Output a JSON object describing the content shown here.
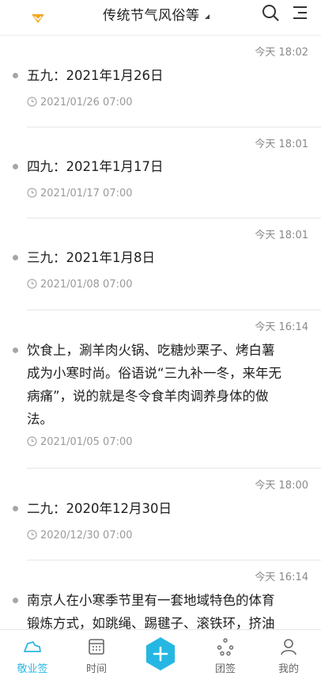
{
  "header": {
    "title": "传统节气风俗等",
    "icons": [
      "app-logo-icon",
      "search-icon",
      "menu-icon"
    ],
    "brand_color": "#f5a623"
  },
  "entries": [
    {
      "time": "今天 18:02",
      "text": "五九：2021年1月26日",
      "reminder": "2021/01/26 07:00"
    },
    {
      "time": "今天 18:01",
      "text": "四九：2021年1月17日",
      "reminder": "2021/01/17 07:00"
    },
    {
      "time": "今天 18:01",
      "text": "三九：2021年1月8日",
      "reminder": "2021/01/08 07:00"
    },
    {
      "time": "今天 16:14",
      "text_lines": [
        "饮食上，涮羊肉火锅、吃糖炒栗子、烤白薯",
        "成为小寒时尚。俗语说“三九补一冬，来年无",
        "病痛”，说的就是冬令食羊肉调养身体的做",
        "法。"
      ],
      "reminder": "2021/01/05 07:00"
    },
    {
      "time": "今天 18:00",
      "text": "二九：2020年12月30日",
      "reminder": "2020/12/30 07:00"
    },
    {
      "time": "今天 16:14",
      "text_lines": [
        "南京人在小寒季节里有一套地域特色的体育",
        "锻炼方式，如跳绳、踢毽子、滚铁环，挤油"
      ]
    }
  ],
  "tabbar": {
    "tabs": [
      {
        "label": "敬业签",
        "icon": "cloud-icon",
        "active": true
      },
      {
        "label": "时间",
        "icon": "calendar-icon",
        "active": false
      },
      {
        "label": "团签",
        "icon": "group-icon",
        "active": false
      },
      {
        "label": "我的",
        "icon": "person-icon",
        "active": false
      }
    ],
    "fab_icon": "plus-icon",
    "accent_color": "#25b7e3"
  }
}
